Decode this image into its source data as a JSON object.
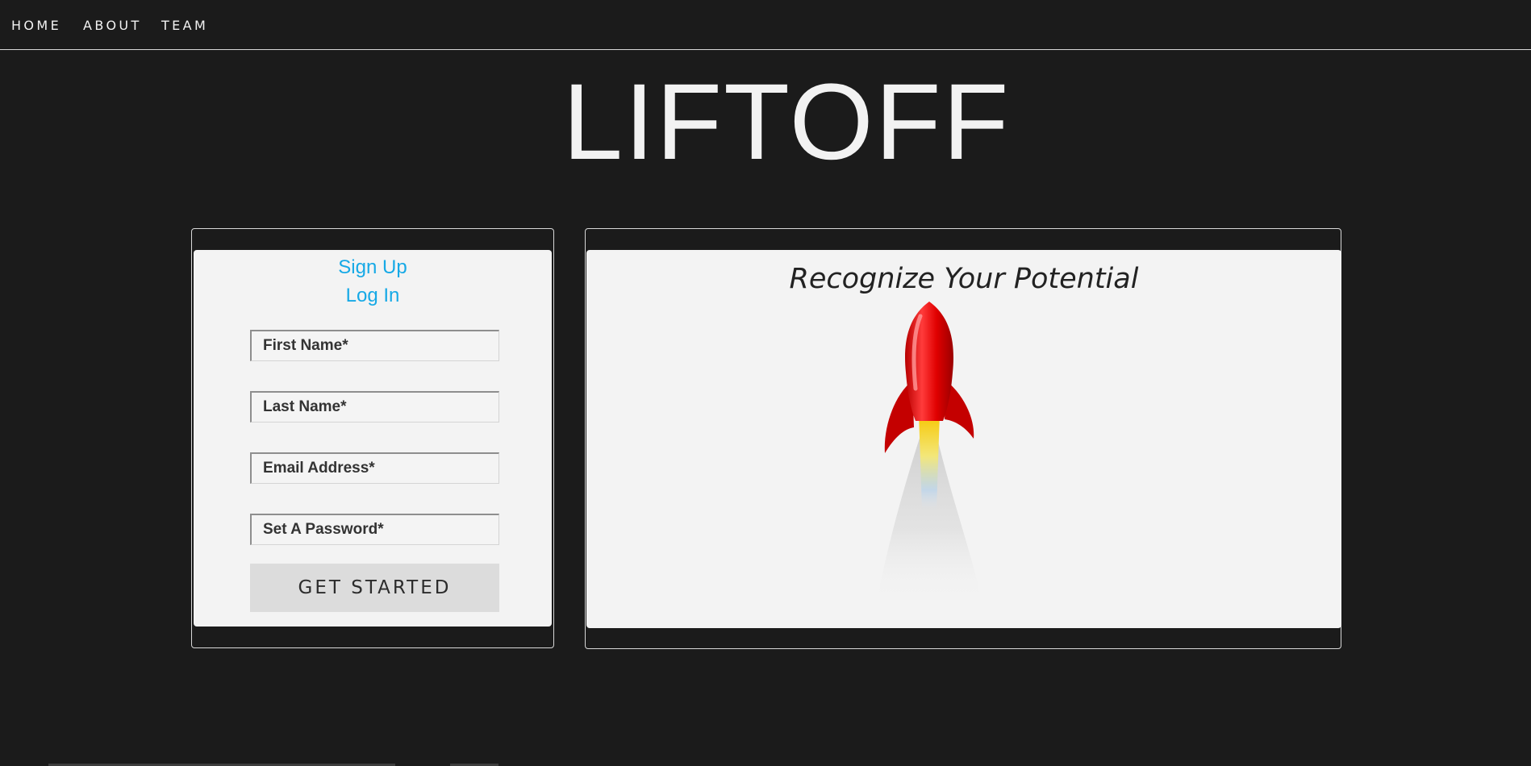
{
  "nav": {
    "items": [
      {
        "label": "HOME"
      },
      {
        "label": "ABOUT"
      },
      {
        "label": "TEAM"
      }
    ]
  },
  "brand": {
    "title": "LIFTOFF"
  },
  "signup": {
    "tabs": [
      {
        "label": "Sign Up"
      },
      {
        "label": "Log In"
      }
    ],
    "fields": [
      {
        "placeholder": "First Name*",
        "value": ""
      },
      {
        "placeholder": "Last Name*",
        "value": ""
      },
      {
        "placeholder": "Email Address*",
        "value": ""
      },
      {
        "placeholder": "Set A Password*",
        "value": ""
      }
    ],
    "submit_label": "GET STARTED"
  },
  "hero": {
    "tagline": "Recognize Your Potential",
    "image": "rocket-launch-illustration"
  },
  "colors": {
    "background": "#1b1b1b",
    "panel": "#f3f3f3",
    "link": "#16a9e6",
    "rocket": "#e00000",
    "button": "#dcdcdc"
  }
}
